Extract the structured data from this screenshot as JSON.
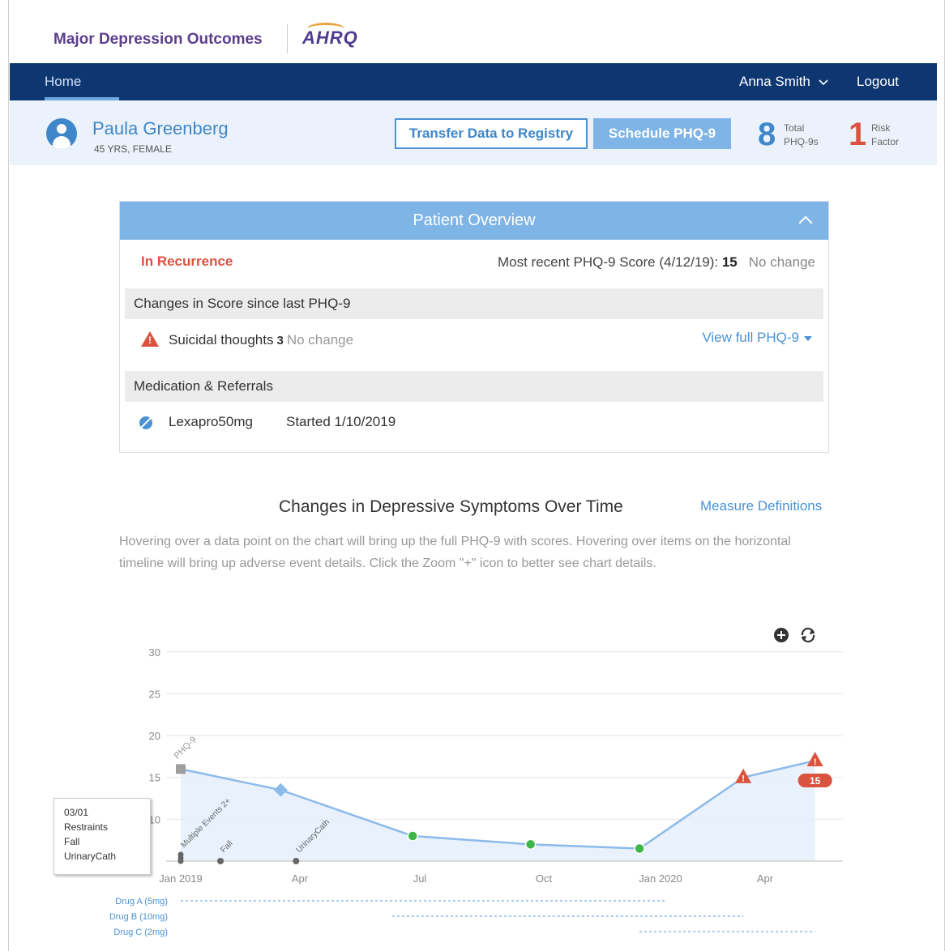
{
  "brand": {
    "title": "Major Depression Outcomes",
    "logo": "AHRQ"
  },
  "nav": {
    "home": "Home",
    "user": "Anna Smith",
    "logout": "Logout"
  },
  "patient": {
    "name": "Paula Greenberg",
    "demographics": "45 YRS, FEMALE",
    "transfer_label": "Transfer Data to Registry",
    "schedule_label": "Schedule PHQ-9",
    "stats": [
      {
        "value": "8",
        "line1": "Total",
        "line2": "PHQ-9s",
        "color": "#3f87c9"
      },
      {
        "value": "1",
        "line1": "Risk",
        "line2": "Factor",
        "color": "#d9533f"
      }
    ]
  },
  "overview": {
    "title": "Patient Overview",
    "status": "In Recurrence",
    "recent_label": "Most recent PHQ-9 Score (4/12/19):",
    "recent_score": "15",
    "recent_change": "No change",
    "changes_header": "Changes in Score since last PHQ-9",
    "symptom": "Suicidal thoughts",
    "symptom_score": "3",
    "symptom_change": "No change",
    "view_full": "View full PHQ-9",
    "meds_header": "Medication & Referrals",
    "med_name": "Lexapro50mg",
    "med_started": "Started 1/10/2019"
  },
  "chart_section": {
    "title": "Changes in Depressive Symptoms Over Time",
    "measure_link": "Measure Definitions",
    "description": "Hovering over a data point on the chart will bring up the full PHQ-9 with scores. Hovering over items on the horizontal timeline will bring up adverse event details. Click the Zoom \"+\" icon to better see chart details."
  },
  "tooltip": {
    "lines": [
      "03/01",
      "Restraints",
      "Fall",
      "UrinaryCath"
    ]
  },
  "chart_data": {
    "type": "line",
    "ylim": [
      0,
      30
    ],
    "yticks": [
      "30",
      "25",
      "20",
      "15",
      "10"
    ],
    "xtick_labels": [
      "Jan 2019",
      "Apr",
      "Jul",
      "Oct",
      "Jan 2020",
      "Apr"
    ],
    "series": [
      {
        "x": [
          "2019-01-01",
          "2019-03-20",
          "2019-07-01",
          "2019-10-01",
          "2019-12-25",
          "2020-03-15",
          "2020-05-10"
        ],
        "y": [
          16,
          13.5,
          8,
          7,
          6.5,
          15,
          17
        ],
        "markers": [
          "square",
          "diamond",
          "circle",
          "circle",
          "circle",
          "warning",
          "warning"
        ]
      }
    ],
    "point_annotation": "PHQ-9",
    "last_value_badge": "15",
    "events": [
      {
        "x": "2019-01-01",
        "label": "Multiple Events 2+"
      },
      {
        "x": "2019-02-01",
        "label": "Fall"
      },
      {
        "x": "2019-04-01",
        "label": "UrinaryCath"
      }
    ],
    "drugs": [
      {
        "name": "Drug A (5mg)",
        "start": "2019-01-01",
        "end": "2020-01-15"
      },
      {
        "name": "Drug B (10mg)",
        "start": "2019-06-15",
        "end": "2020-03-15"
      },
      {
        "name": "Drug C (2mg)",
        "start": "2019-12-25",
        "end": "2020-05-10"
      }
    ],
    "colors": {
      "line": "#8cbaea",
      "area": "#e4eefb",
      "green": "#3fb54a",
      "warning": "#d9533f",
      "square": "#9e9e9e",
      "diamond": "#8cbaea"
    }
  }
}
